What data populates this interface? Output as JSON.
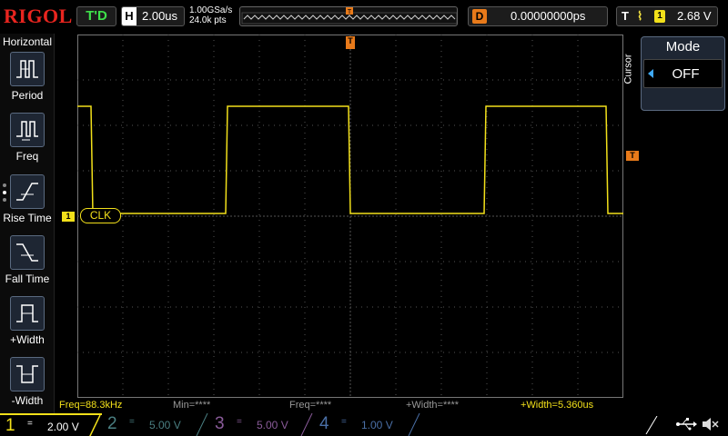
{
  "brand": {
    "logo": "RIGOL"
  },
  "top": {
    "run_state": "T'D",
    "horizontal": {
      "label": "H",
      "value": "2.00us"
    },
    "sampling": {
      "rate": "1.00GSa/s",
      "points": "24.0k pts"
    },
    "delay": {
      "label": "D",
      "value": "0.00000000ps"
    },
    "trigger": {
      "label": "T",
      "edge": "⌇",
      "channel": "1",
      "level": "2.68 V"
    },
    "memory_marker": "T"
  },
  "left_menu": {
    "title": "Horizontal",
    "items": [
      {
        "label": "Period",
        "icon": "period-icon"
      },
      {
        "label": "Freq",
        "icon": "freq-icon"
      },
      {
        "label": "Rise Time",
        "icon": "rise-time-icon"
      },
      {
        "label": "Fall Time",
        "icon": "fall-time-icon"
      },
      {
        "label": "+Width",
        "icon": "pos-width-icon"
      },
      {
        "label": "-Width",
        "icon": "neg-width-icon"
      }
    ]
  },
  "right_panel": {
    "side_label": "Cursor",
    "title": "Mode",
    "value": "OFF"
  },
  "markers": {
    "trigger_pos": "T",
    "trigger_level": "T",
    "ch1": "1",
    "ch1_label": "CLK"
  },
  "measurements": {
    "freq": "Freq=88.3kHz",
    "min": "Min=****",
    "freq2": "Freq=****",
    "width": "+Width=****",
    "width2": "+Width=5.360us"
  },
  "channels": [
    {
      "num": "1",
      "coupling": "=",
      "scale": "2.00 V",
      "color": "#f2e01a"
    },
    {
      "num": "2",
      "coupling": "=",
      "scale": "5.00 V",
      "color": "#4a7f82"
    },
    {
      "num": "3",
      "coupling": "=",
      "scale": "5.00 V",
      "color": "#8a5b9a"
    },
    {
      "num": "4",
      "coupling": "=",
      "scale": "1.00 V",
      "color": "#4a6fa6"
    }
  ],
  "status": {
    "icons": [
      "usb-icon",
      "speaker-muted-icon"
    ]
  },
  "colors": {
    "ch1": "#f2e01a",
    "trigger": "#e87a1a",
    "grid": "#555555",
    "brand": "#e8251f"
  }
}
